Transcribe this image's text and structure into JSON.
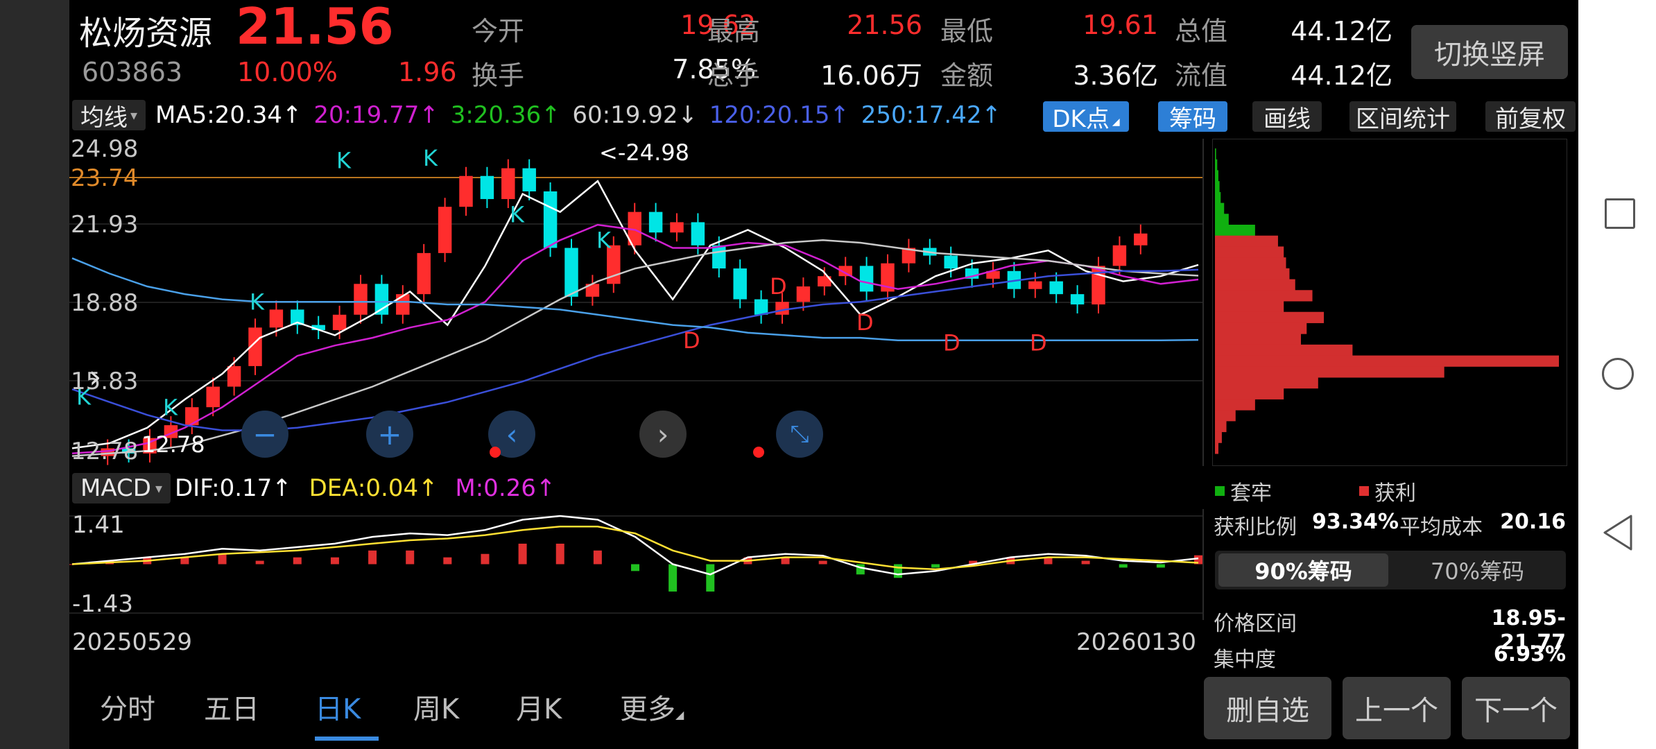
{
  "stock": {
    "name": "松炀资源",
    "price": "21.56",
    "code": "603863",
    "change_pct": "10.00%",
    "change": "1.96"
  },
  "quote": {
    "open_label": "今开",
    "open": "19.62",
    "high_label": "最高",
    "high": "21.56",
    "low_label": "最低",
    "low": "19.61",
    "mktcap_label": "总值",
    "mktcap": "44.12亿",
    "turnover_label": "换手",
    "turnover": "7.85%",
    "volume_label": "总手",
    "volume": "16.06万",
    "amount_label": "金额",
    "amount": "3.36亿",
    "float_label": "流值",
    "float": "44.12亿"
  },
  "switch_button": "切换竖屏",
  "ma_bar": {
    "selector": "均线",
    "ma5": "MA5:20.34↑",
    "ma20": "20:19.77↑",
    "ma3": "3:20.36↑",
    "ma60": "60:19.92↓",
    "ma120": "120:20.15↑",
    "ma250": "250:17.42↑"
  },
  "tools": {
    "dk": "DK点",
    "chips": "筹码",
    "draw": "画线",
    "range": "区间统计",
    "adjust": "前复权"
  },
  "price_axis": [
    "24.98",
    "23.74",
    "21.93",
    "18.88",
    "15.83",
    "12.78"
  ],
  "max_marker": "<-24.98",
  "min_marker": "12.78",
  "macd_bar": {
    "selector": "MACD",
    "dif": "DIF:0.17↑",
    "dea": "DEA:0.04↑",
    "m": "M:0.26↑"
  },
  "macd_axis": [
    "1.41",
    "-1.43"
  ],
  "date_start": "20250529",
  "date_end": "20260130",
  "bottom_tabs": [
    "分时",
    "五日",
    "日K",
    "周K",
    "月K",
    "更多"
  ],
  "chip_panel": {
    "legend_trapped": "套牢",
    "legend_profit": "获利",
    "profit_ratio_label": "获利比例",
    "profit_ratio": "93.34%",
    "avg_cost_label": "平均成本",
    "avg_cost": "20.16",
    "tab_90": "90%筹码",
    "tab_70": "70%筹码",
    "range_label": "价格区间",
    "range": "18.95-21.77",
    "conc_label": "集中度",
    "conc": "6.93%"
  },
  "actions": {
    "remove": "删自选",
    "prev": "上一个",
    "next": "下一个"
  },
  "colors": {
    "up": "#ff2d2d",
    "down": "#00e5e5",
    "ma5": "#ffffff",
    "ma20": "#d020d0",
    "ma60": "#c8c8c8",
    "ma120": "#3a4fd8",
    "ma250": "#4aa0e8",
    "dif": "#ffffff",
    "dea": "#ffe033",
    "accent": "#2d7fd6"
  },
  "chart_data": {
    "type": "line",
    "x_range": [
      "20250529",
      "20260130"
    ],
    "ylim": [
      12.78,
      24.98
    ],
    "series": [
      {
        "name": "MA5:20.34↑",
        "values": [
          13.2,
          13.4,
          14.0,
          15.1,
          16.1,
          17.5,
          18.1,
          17.6,
          18.4,
          19.3,
          18.0,
          20.3,
          23.1,
          22.4,
          23.6,
          20.9,
          19.0,
          21.1,
          21.7,
          21.0,
          20.1,
          18.4,
          19.1,
          19.9,
          20.4,
          20.6,
          20.9,
          20.1,
          19.7,
          19.9,
          20.34
        ]
      },
      {
        "name": "20:19.77↑",
        "values": [
          13.0,
          13.1,
          13.4,
          14.0,
          14.8,
          15.8,
          16.8,
          17.2,
          17.5,
          17.9,
          18.2,
          18.9,
          20.5,
          21.3,
          21.9,
          21.7,
          21.0,
          21.0,
          21.2,
          21.1,
          20.5,
          19.7,
          19.4,
          19.6,
          19.9,
          20.3,
          20.5,
          20.3,
          19.9,
          19.6,
          19.77
        ]
      },
      {
        "name": "60:19.92↓",
        "values": [
          12.9,
          13.0,
          13.1,
          13.3,
          13.7,
          14.1,
          14.6,
          15.1,
          15.6,
          16.2,
          16.8,
          17.4,
          18.2,
          19.0,
          19.7,
          20.2,
          20.5,
          20.8,
          21.0,
          21.2,
          21.3,
          21.2,
          21.0,
          20.8,
          20.7,
          20.6,
          20.5,
          20.3,
          20.1,
          20.0,
          19.92
        ]
      },
      {
        "name": "120:20.15↑",
        "values": [
          15.5,
          15.0,
          14.5,
          14.1,
          13.9,
          13.9,
          14.0,
          14.2,
          14.4,
          14.7,
          15.0,
          15.4,
          15.8,
          16.3,
          16.8,
          17.2,
          17.6,
          18.0,
          18.3,
          18.6,
          18.8,
          18.9,
          19.1,
          19.3,
          19.5,
          19.7,
          19.9,
          20.0,
          20.1,
          20.1,
          20.15
        ]
      },
      {
        "name": "250:17.42↑",
        "values": [
          20.6,
          20.0,
          19.5,
          19.2,
          19.0,
          18.9,
          18.9,
          18.9,
          18.9,
          18.9,
          18.8,
          18.8,
          18.7,
          18.6,
          18.4,
          18.2,
          18.0,
          17.9,
          17.7,
          17.6,
          17.5,
          17.5,
          17.4,
          17.4,
          17.4,
          17.4,
          17.4,
          17.4,
          17.4,
          17.4,
          17.42
        ]
      }
    ],
    "closes": [
      13.2,
      13.0,
      13.6,
      14.1,
      14.8,
      15.6,
      16.4,
      17.9,
      18.6,
      18.0,
      17.8,
      18.4,
      19.6,
      18.4,
      19.2,
      20.8,
      22.6,
      23.8,
      22.9,
      24.1,
      23.2,
      21.0,
      19.1,
      19.6,
      21.1,
      22.4,
      21.6,
      22.0,
      21.1,
      20.2,
      19.0,
      18.4,
      18.9,
      19.5,
      19.9,
      20.3,
      19.3,
      20.4,
      21.0,
      20.7,
      20.2,
      19.8,
      20.1,
      19.4,
      19.7,
      19.2,
      18.8,
      20.3,
      21.1,
      21.56
    ],
    "dk_markers": [
      {
        "label": "K",
        "price": 14.9
      },
      {
        "label": "K",
        "price": 14.5
      },
      {
        "label": "K",
        "price": 18.6
      },
      {
        "label": "K",
        "price": 24.1
      },
      {
        "label": "K",
        "price": 24.2
      },
      {
        "label": "K",
        "price": 22.0
      },
      {
        "label": "K",
        "price": 21.0
      },
      {
        "label": "D",
        "price": 17.1
      },
      {
        "label": "D",
        "price": 19.2
      },
      {
        "label": "D",
        "price": 17.8
      },
      {
        "label": "D",
        "price": 17.0
      },
      {
        "label": "D",
        "price": 17.0
      }
    ],
    "macd": {
      "ylim": [
        -1.43,
        1.41
      ],
      "dif": [
        0.0,
        0.1,
        0.2,
        0.3,
        0.45,
        0.4,
        0.5,
        0.6,
        0.8,
        0.9,
        0.85,
        1.0,
        1.3,
        1.41,
        1.3,
        0.8,
        0.0,
        -0.3,
        0.2,
        0.3,
        0.25,
        -0.1,
        -0.3,
        -0.2,
        0.0,
        0.2,
        0.3,
        0.25,
        0.1,
        0.05,
        0.17
      ],
      "dea": [
        0.0,
        0.05,
        0.1,
        0.2,
        0.3,
        0.35,
        0.4,
        0.5,
        0.6,
        0.7,
        0.75,
        0.85,
        1.0,
        1.1,
        1.1,
        0.9,
        0.4,
        0.1,
        0.1,
        0.2,
        0.2,
        0.05,
        -0.1,
        -0.15,
        -0.05,
        0.1,
        0.2,
        0.2,
        0.15,
        0.1,
        0.04
      ],
      "hist": [
        0.0,
        0.1,
        0.2,
        0.2,
        0.3,
        0.1,
        0.2,
        0.2,
        0.4,
        0.4,
        0.2,
        0.3,
        0.6,
        0.6,
        0.4,
        -0.2,
        -0.8,
        -0.8,
        0.2,
        0.2,
        0.1,
        -0.3,
        -0.4,
        -0.1,
        0.1,
        0.2,
        0.2,
        0.1,
        -0.1,
        -0.1,
        0.26
      ]
    },
    "chip_distribution": {
      "price_levels": [
        23.0,
        22.8,
        22.6,
        22.4,
        22.2,
        22.0,
        21.8,
        21.6,
        21.4,
        21.2,
        21.0,
        20.8,
        20.6,
        20.4,
        20.2,
        20.0,
        19.8,
        19.6,
        19.4,
        19.2,
        19.0,
        18.8,
        18.6,
        18.4,
        18.2,
        18.0,
        17.8,
        17.6
      ],
      "volume": [
        1,
        2,
        3,
        4,
        5,
        8,
        12,
        35,
        55,
        60,
        62,
        65,
        70,
        85,
        60,
        95,
        80,
        75,
        120,
        300,
        200,
        90,
        60,
        35,
        18,
        10,
        6,
        3
      ],
      "profit_split_price": 21.56
    }
  }
}
